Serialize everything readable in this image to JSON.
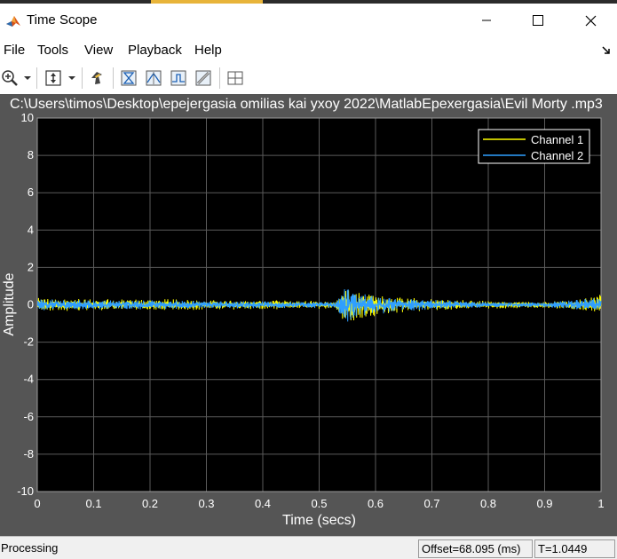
{
  "window": {
    "title": "Time Scope",
    "controls": [
      "minimize",
      "maximize",
      "close"
    ]
  },
  "menu": {
    "items": [
      "File",
      "Tools",
      "View",
      "Playback",
      "Help"
    ]
  },
  "toolbar": {
    "icons": [
      "zoom-in-icon",
      "dropdown-arrow-icon",
      "scale-axes-icon",
      "dropdown-arrow-icon",
      "simulink-highlight-icon",
      "triggers-icon",
      "cursor-measurements-icon",
      "signal-statistics-icon",
      "bilevel-measurements-icon",
      "peak-finder-icon",
      "layout-icon"
    ]
  },
  "plot": {
    "title": "C:\\Users\\timos\\Desktop\\epejergasia omilias kai yxoy 2022\\MatlabEpexergasia\\Evil Morty .mp3"
  },
  "chart_data": {
    "type": "line",
    "title": "C:\\Users\\timos\\Desktop\\epejergasia omilias kai yxoy 2022\\MatlabEpexergasia\\Evil Morty .mp3",
    "xlabel": "Time (secs)",
    "ylabel": "Amplitude",
    "xlim": [
      0,
      1
    ],
    "ylim": [
      -10,
      10
    ],
    "x_ticks": [
      "0",
      "0.1",
      "0.2",
      "0.3",
      "0.4",
      "0.5",
      "0.6",
      "0.7",
      "0.8",
      "0.9",
      "1"
    ],
    "y_ticks": [
      "10",
      "8",
      "6",
      "4",
      "2",
      "0",
      "-2",
      "-4",
      "-6",
      "-8",
      "-10"
    ],
    "grid": true,
    "legend_position": "top-right",
    "series": [
      {
        "name": "Channel 1",
        "color": "#ffff00",
        "envelope": [
          {
            "x": 0.0,
            "amp": 0.35
          },
          {
            "x": 0.1,
            "amp": 0.3
          },
          {
            "x": 0.2,
            "amp": 0.3
          },
          {
            "x": 0.3,
            "amp": 0.25
          },
          {
            "x": 0.4,
            "amp": 0.25
          },
          {
            "x": 0.53,
            "amp": 0.2
          },
          {
            "x": 0.545,
            "amp": 0.9
          },
          {
            "x": 0.58,
            "amp": 0.8
          },
          {
            "x": 0.62,
            "amp": 0.45
          },
          {
            "x": 0.7,
            "amp": 0.3
          },
          {
            "x": 0.8,
            "amp": 0.2
          },
          {
            "x": 0.9,
            "amp": 0.15
          },
          {
            "x": 0.97,
            "amp": 0.3
          },
          {
            "x": 1.0,
            "amp": 0.6
          }
        ]
      },
      {
        "name": "Channel 2",
        "color": "#2f9fff",
        "envelope": [
          {
            "x": 0.0,
            "amp": 0.3
          },
          {
            "x": 0.1,
            "amp": 0.25
          },
          {
            "x": 0.2,
            "amp": 0.25
          },
          {
            "x": 0.3,
            "amp": 0.2
          },
          {
            "x": 0.4,
            "amp": 0.2
          },
          {
            "x": 0.53,
            "amp": 0.15
          },
          {
            "x": 0.545,
            "amp": 1.0
          },
          {
            "x": 0.58,
            "amp": 0.7
          },
          {
            "x": 0.62,
            "amp": 0.4
          },
          {
            "x": 0.7,
            "amp": 0.25
          },
          {
            "x": 0.8,
            "amp": 0.15
          },
          {
            "x": 0.9,
            "amp": 0.12
          },
          {
            "x": 0.97,
            "amp": 0.3
          },
          {
            "x": 1.0,
            "amp": 0.45
          }
        ]
      }
    ]
  },
  "status": {
    "left": "Processing",
    "offset": "Offset=68.095 (ms)",
    "time": "T=1.0449"
  }
}
